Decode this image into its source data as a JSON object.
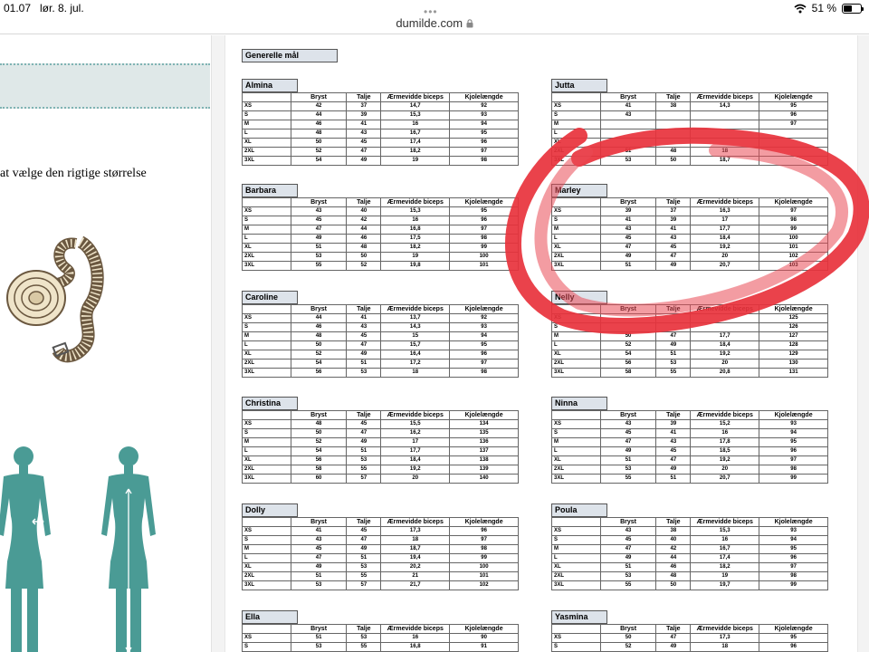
{
  "status_bar": {
    "time": "01.07",
    "date": "lør. 8. jul.",
    "battery_text": "51 %",
    "battery_level": 0.51
  },
  "browser": {
    "url": "dumilde.com"
  },
  "left_page": {
    "text": "at vælge den rigtige størrelse"
  },
  "right_page": {
    "section_title": "Generelle mål"
  },
  "columns": [
    "Bryst",
    "Talje",
    "Ærmevidde biceps",
    "Kjolelængde"
  ],
  "sizes": [
    "XS",
    "S",
    "M",
    "L",
    "XL",
    "2XL",
    "3XL"
  ],
  "blocks": [
    {
      "name": "Almina",
      "rows": [
        [
          "42",
          "37",
          "14,7",
          "92"
        ],
        [
          "44",
          "39",
          "15,3",
          "93"
        ],
        [
          "46",
          "41",
          "16",
          "94"
        ],
        [
          "48",
          "43",
          "16,7",
          "95"
        ],
        [
          "50",
          "45",
          "17,4",
          "96"
        ],
        [
          "52",
          "47",
          "18,2",
          "97"
        ],
        [
          "54",
          "49",
          "19",
          "98"
        ]
      ]
    },
    {
      "name": "Jutta",
      "rows": [
        [
          "41",
          "38",
          "14,3",
          "95"
        ],
        [
          "43",
          "",
          "",
          "96"
        ],
        [
          "",
          "",
          "",
          "97"
        ],
        [
          "",
          "",
          "",
          ""
        ],
        [
          "",
          "",
          "",
          ""
        ],
        [
          "51",
          "48",
          "18",
          ""
        ],
        [
          "53",
          "50",
          "18,7",
          ""
        ]
      ]
    },
    {
      "name": "Barbara",
      "rows": [
        [
          "43",
          "40",
          "15,3",
          "95"
        ],
        [
          "45",
          "42",
          "16",
          "96"
        ],
        [
          "47",
          "44",
          "16,8",
          "97"
        ],
        [
          "49",
          "46",
          "17,5",
          "98"
        ],
        [
          "51",
          "48",
          "18,2",
          "99"
        ],
        [
          "53",
          "50",
          "19",
          "100"
        ],
        [
          "55",
          "52",
          "19,8",
          "101"
        ]
      ]
    },
    {
      "name": "Marley",
      "rows": [
        [
          "39",
          "37",
          "16,3",
          "97"
        ],
        [
          "41",
          "39",
          "17",
          "98"
        ],
        [
          "43",
          "41",
          "17,7",
          "99"
        ],
        [
          "45",
          "43",
          "18,4",
          "100"
        ],
        [
          "47",
          "45",
          "19,2",
          "101"
        ],
        [
          "49",
          "47",
          "20",
          "102"
        ],
        [
          "51",
          "49",
          "20,7",
          "103"
        ]
      ]
    },
    {
      "name": "Caroline",
      "rows": [
        [
          "44",
          "41",
          "13,7",
          "92"
        ],
        [
          "46",
          "43",
          "14,3",
          "93"
        ],
        [
          "48",
          "45",
          "15",
          "94"
        ],
        [
          "50",
          "47",
          "15,7",
          "95"
        ],
        [
          "52",
          "49",
          "16,4",
          "96"
        ],
        [
          "54",
          "51",
          "17,2",
          "97"
        ],
        [
          "56",
          "53",
          "18",
          "98"
        ]
      ]
    },
    {
      "name": "Nelly",
      "rows": [
        [
          "",
          "",
          "",
          "125"
        ],
        [
          "",
          "",
          "",
          "126"
        ],
        [
          "50",
          "47",
          "17,7",
          "127"
        ],
        [
          "52",
          "49",
          "18,4",
          "128"
        ],
        [
          "54",
          "51",
          "19,2",
          "129"
        ],
        [
          "56",
          "53",
          "20",
          "130"
        ],
        [
          "58",
          "55",
          "20,8",
          "131"
        ]
      ]
    },
    {
      "name": "Christina",
      "rows": [
        [
          "48",
          "45",
          "15,5",
          "134"
        ],
        [
          "50",
          "47",
          "16,2",
          "135"
        ],
        [
          "52",
          "49",
          "17",
          "136"
        ],
        [
          "54",
          "51",
          "17,7",
          "137"
        ],
        [
          "56",
          "53",
          "18,4",
          "138"
        ],
        [
          "58",
          "55",
          "19,2",
          "139"
        ],
        [
          "60",
          "57",
          "20",
          "140"
        ]
      ]
    },
    {
      "name": "Ninna",
      "rows": [
        [
          "43",
          "39",
          "15,2",
          "93"
        ],
        [
          "45",
          "41",
          "16",
          "94"
        ],
        [
          "47",
          "43",
          "17,8",
          "95"
        ],
        [
          "49",
          "45",
          "18,5",
          "96"
        ],
        [
          "51",
          "47",
          "19,2",
          "97"
        ],
        [
          "53",
          "49",
          "20",
          "98"
        ],
        [
          "55",
          "51",
          "20,7",
          "99"
        ]
      ]
    },
    {
      "name": "Dolly",
      "rows": [
        [
          "41",
          "45",
          "17,3",
          "96"
        ],
        [
          "43",
          "47",
          "18",
          "97"
        ],
        [
          "45",
          "49",
          "18,7",
          "98"
        ],
        [
          "47",
          "51",
          "19,4",
          "99"
        ],
        [
          "49",
          "53",
          "20,2",
          "100"
        ],
        [
          "51",
          "55",
          "21",
          "101"
        ],
        [
          "53",
          "57",
          "21,7",
          "102"
        ]
      ]
    },
    {
      "name": "Poula",
      "rows": [
        [
          "43",
          "38",
          "15,3",
          "93"
        ],
        [
          "45",
          "40",
          "16",
          "94"
        ],
        [
          "47",
          "42",
          "16,7",
          "95"
        ],
        [
          "49",
          "44",
          "17,4",
          "96"
        ],
        [
          "51",
          "46",
          "18,2",
          "97"
        ],
        [
          "53",
          "48",
          "19",
          "98"
        ],
        [
          "55",
          "50",
          "19,7",
          "99"
        ]
      ]
    },
    {
      "name": "Ella",
      "rows": [
        [
          "51",
          "53",
          "16",
          "90"
        ],
        [
          "53",
          "55",
          "16,8",
          "91"
        ]
      ]
    },
    {
      "name": "Yasmina",
      "rows": [
        [
          "50",
          "47",
          "17,3",
          "95"
        ],
        [
          "52",
          "49",
          "18",
          "96"
        ]
      ]
    }
  ],
  "colors": {
    "accent": "#e8323c",
    "teal": "#4a9b95",
    "header_fill": "#dde3ea"
  }
}
